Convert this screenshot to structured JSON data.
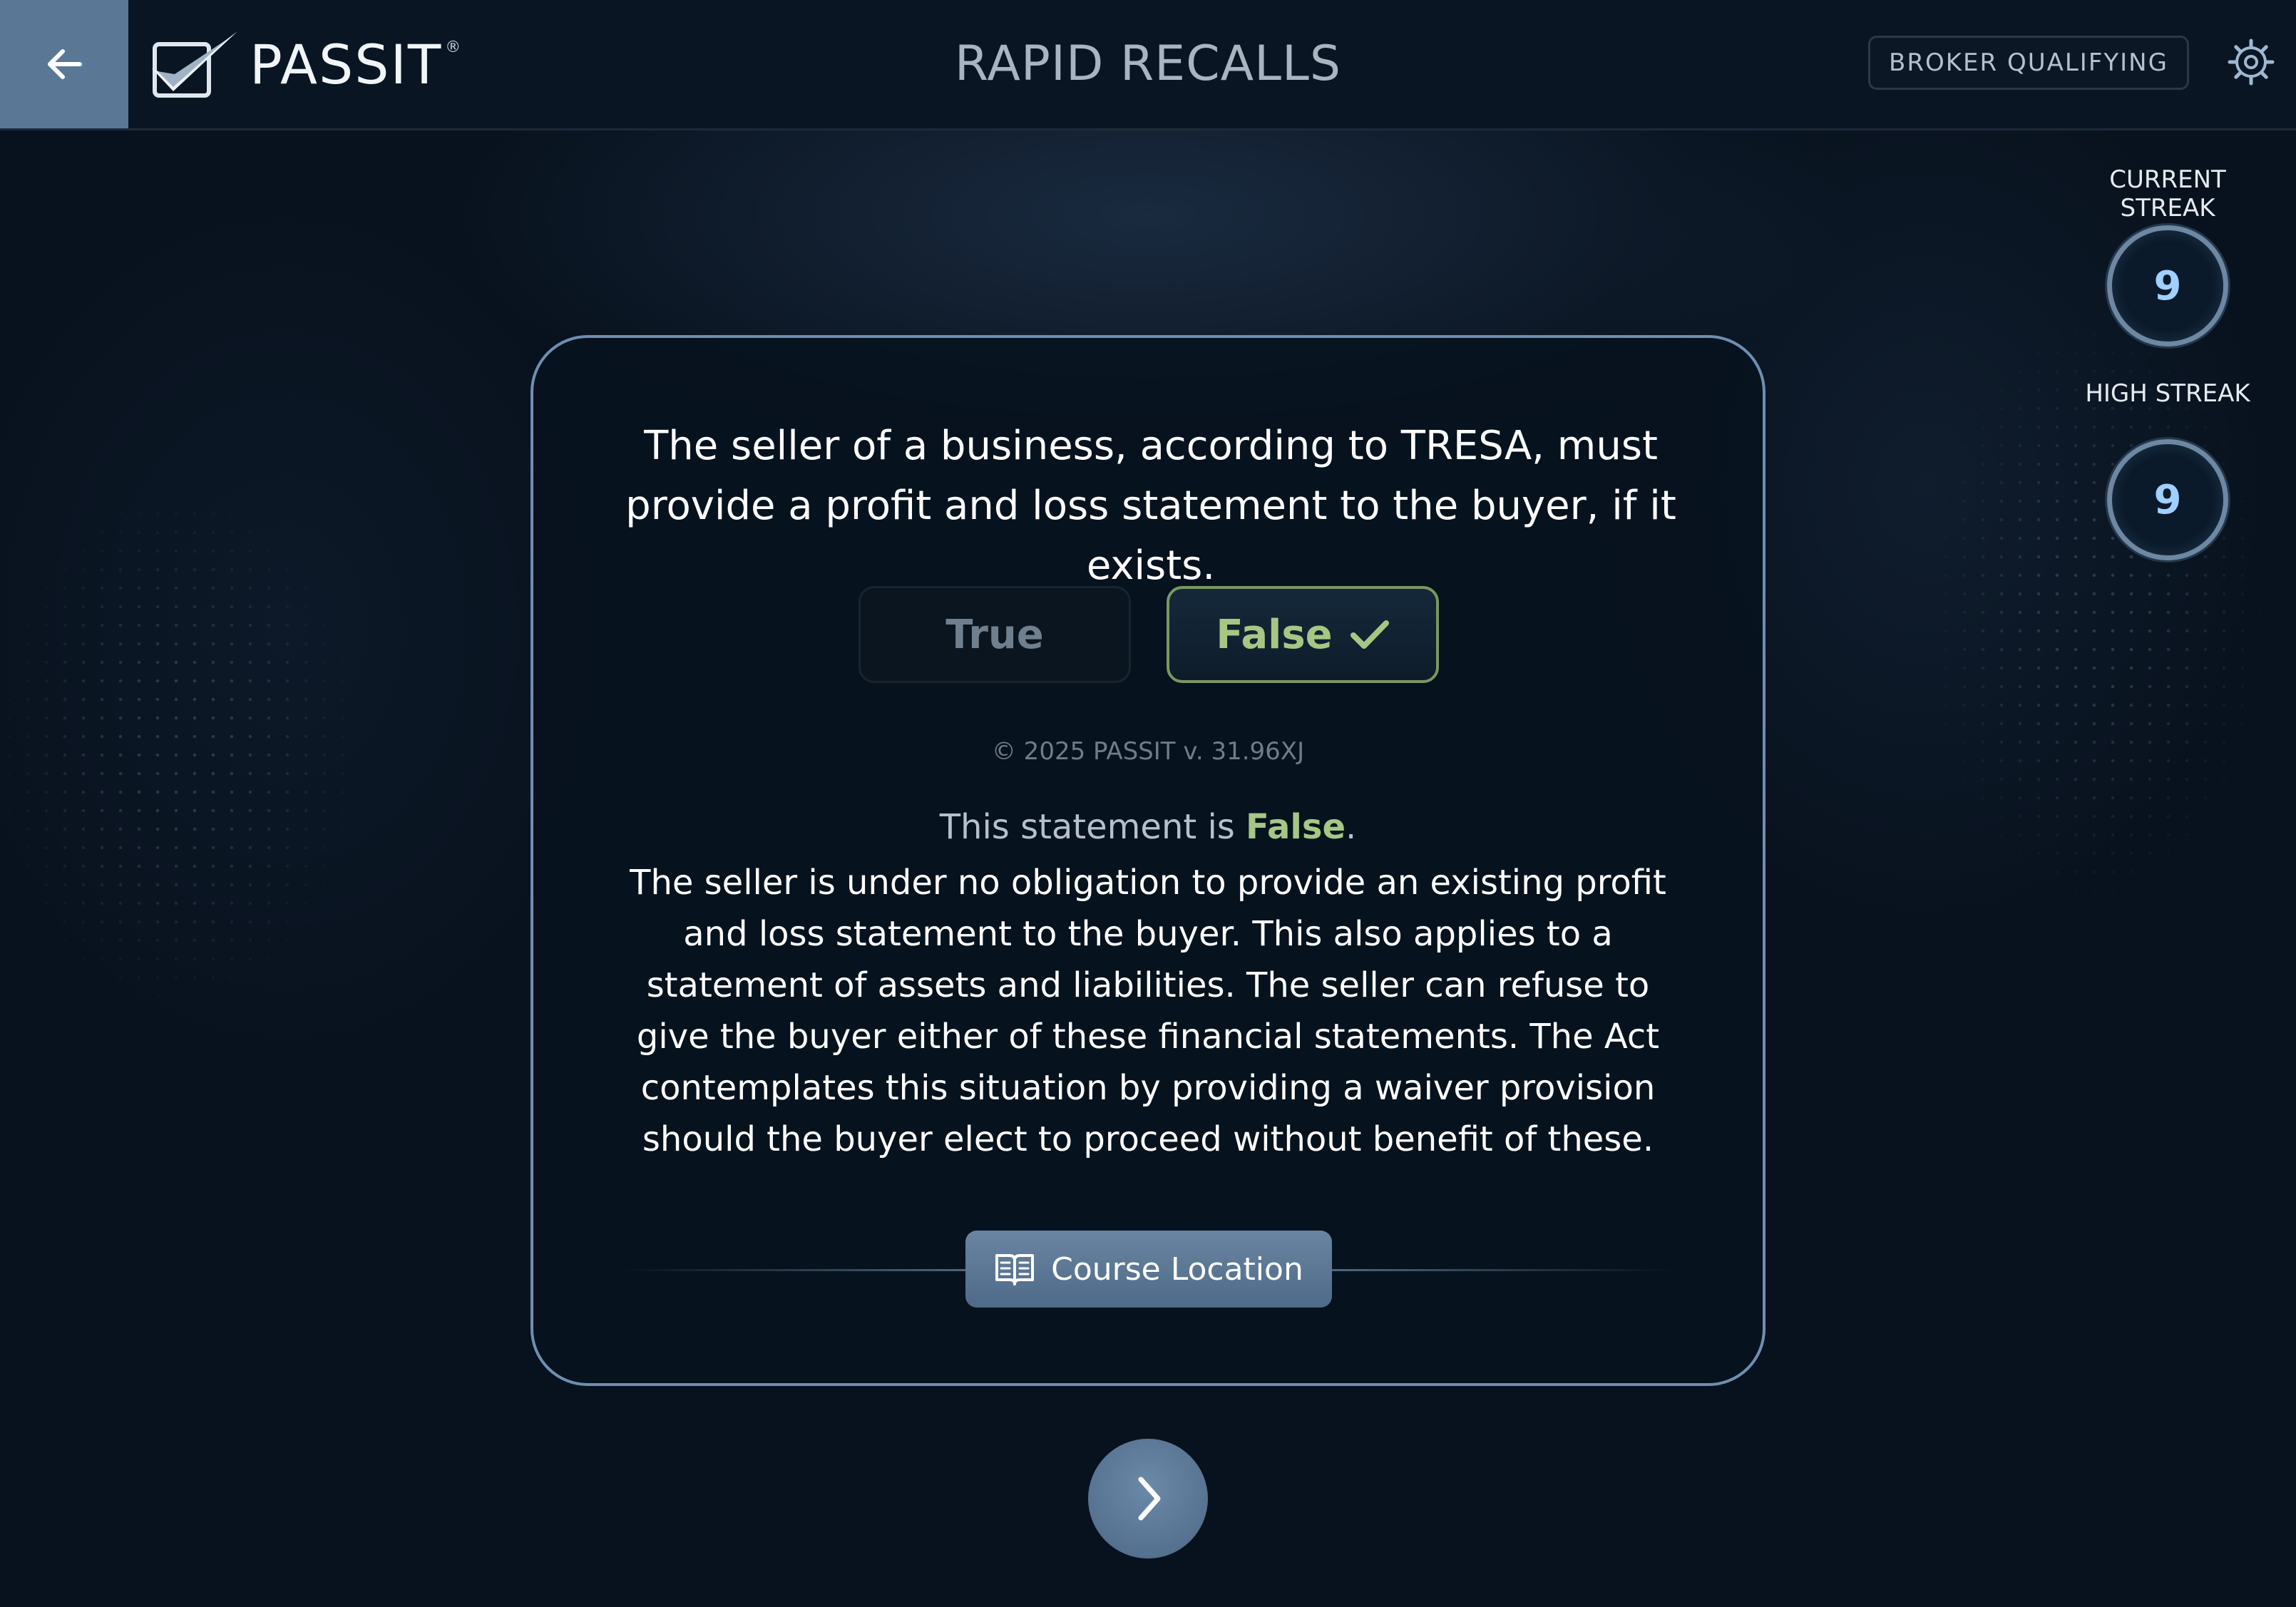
{
  "header": {
    "brand": "PASSIT",
    "brand_mark": "®",
    "title": "RAPID RECALLS",
    "mode": "BROKER QUALIFYING",
    "back_icon": "arrow-left-icon",
    "settings_icon": "gear-icon"
  },
  "streaks": {
    "current_label": "CURRENT STREAK",
    "current_value": "9",
    "high_label": "HIGH STREAK",
    "high_value": "9"
  },
  "card": {
    "question": "The seller of a business, according to TRESA, must provide a profit and loss statement to the buyer, if it exists.",
    "answers": {
      "true_label": "True",
      "false_label": "False"
    },
    "selected_answer": "False",
    "copyright": "© 2025 PASSIT v. 31.96XJ",
    "verdict_prefix": "This statement is ",
    "verdict_value": "False",
    "verdict_suffix": ".",
    "explanation": "The seller is under no obligation to provide an existing profit and loss statement to the buyer. This also applies to a statement of assets and liabilities. The seller can refuse to give the buyer either of these financial statements. The Act contemplates this situation by providing a waiver provision should the buyer elect to proceed without benefit of these.",
    "course_location_label": "Course Location"
  },
  "colors": {
    "background": "#08121e",
    "accent": "#5a7896",
    "correct": "#a6c784",
    "card_border": "#6e8fb2",
    "streak_value": "#9fd0ff"
  },
  "icons": {
    "next": "chevron-right-icon",
    "course": "open-book-icon",
    "check": "checkmark-icon"
  }
}
